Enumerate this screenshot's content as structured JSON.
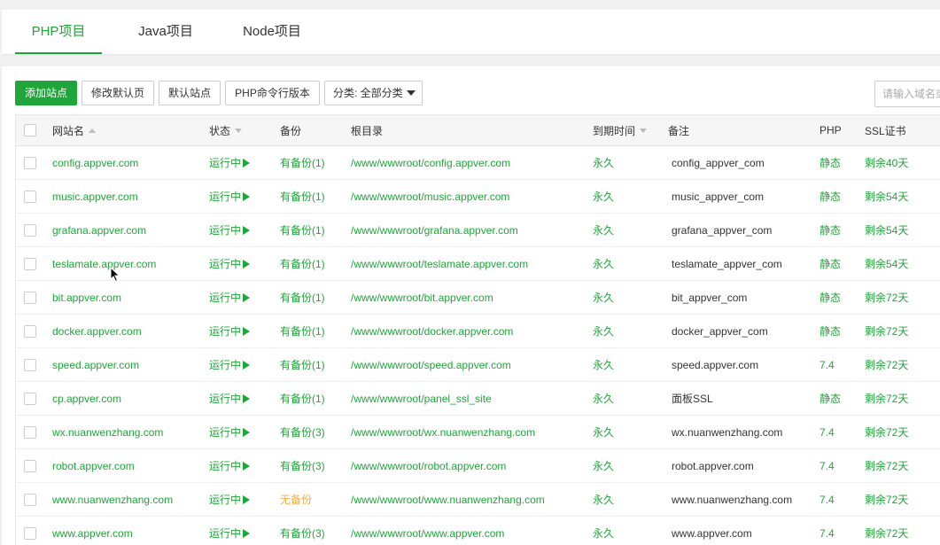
{
  "tabs": [
    {
      "label": "PHP项目",
      "active": true
    },
    {
      "label": "Java项目",
      "active": false
    },
    {
      "label": "Node项目",
      "active": false
    }
  ],
  "toolbar": {
    "add_site": "添加站点",
    "edit_default_page": "修改默认页",
    "default_site": "默认站点",
    "php_cli_version": "PHP命令行版本",
    "category_select": "分类: 全部分类",
    "search_placeholder": "请输入域名或备注"
  },
  "table": {
    "headers": {
      "site_name": "网站名",
      "status": "状态",
      "backup": "备份",
      "root": "根目录",
      "expiry": "到期时间",
      "remark": "备注",
      "php": "PHP",
      "ssl": "SSL证书"
    },
    "rows": [
      {
        "name": "config.appver.com",
        "status": "运行中",
        "backup": "有备份(1)",
        "root": "/www/wwwroot/config.appver.com",
        "expiry": "永久",
        "remark": "config_appver_com",
        "php": "静态",
        "ssl": "剩余40天"
      },
      {
        "name": "music.appver.com",
        "status": "运行中",
        "backup": "有备份(1)",
        "root": "/www/wwwroot/music.appver.com",
        "expiry": "永久",
        "remark": "music_appver_com",
        "php": "静态",
        "ssl": "剩余54天"
      },
      {
        "name": "grafana.appver.com",
        "status": "运行中",
        "backup": "有备份(1)",
        "root": "/www/wwwroot/grafana.appver.com",
        "expiry": "永久",
        "remark": "grafana_appver_com",
        "php": "静态",
        "ssl": "剩余54天"
      },
      {
        "name": "teslamate.appver.com",
        "status": "运行中",
        "backup": "有备份(1)",
        "root": "/www/wwwroot/teslamate.appver.com",
        "expiry": "永久",
        "remark": "teslamate_appver_com",
        "php": "静态",
        "ssl": "剩余54天"
      },
      {
        "name": "bit.appver.com",
        "status": "运行中",
        "backup": "有备份(1)",
        "root": "/www/wwwroot/bit.appver.com",
        "expiry": "永久",
        "remark": "bit_appver_com",
        "php": "静态",
        "ssl": "剩余72天"
      },
      {
        "name": "docker.appver.com",
        "status": "运行中",
        "backup": "有备份(1)",
        "root": "/www/wwwroot/docker.appver.com",
        "expiry": "永久",
        "remark": "docker_appver_com",
        "php": "静态",
        "ssl": "剩余72天"
      },
      {
        "name": "speed.appver.com",
        "status": "运行中",
        "backup": "有备份(1)",
        "root": "/www/wwwroot/speed.appver.com",
        "expiry": "永久",
        "remark": "speed.appver.com",
        "php": "7.4",
        "ssl": "剩余72天"
      },
      {
        "name": "cp.appver.com",
        "status": "运行中",
        "backup": "有备份(1)",
        "root": "/www/wwwroot/panel_ssl_site",
        "expiry": "永久",
        "remark": "面板SSL",
        "php": "静态",
        "ssl": "剩余72天"
      },
      {
        "name": "wx.nuanwenzhang.com",
        "status": "运行中",
        "backup": "有备份(3)",
        "root": "/www/wwwroot/wx.nuanwenzhang.com",
        "expiry": "永久",
        "remark": "wx.nuanwenzhang.com",
        "php": "7.4",
        "ssl": "剩余72天"
      },
      {
        "name": "robot.appver.com",
        "status": "运行中",
        "backup": "有备份(3)",
        "root": "/www/wwwroot/robot.appver.com",
        "expiry": "永久",
        "remark": "robot.appver.com",
        "php": "7.4",
        "ssl": "剩余72天"
      },
      {
        "name": "www.nuanwenzhang.com",
        "status": "运行中",
        "backup": "无备份",
        "root": "/www/wwwroot/www.nuanwenzhang.com",
        "expiry": "永久",
        "remark": "www.nuanwenzhang.com",
        "php": "7.4",
        "ssl": "剩余72天"
      },
      {
        "name": "www.appver.com",
        "status": "运行中",
        "backup": "有备份(3)",
        "root": "/www/wwwroot/www.appver.com",
        "expiry": "永久",
        "remark": "www.appver.com",
        "php": "7.4",
        "ssl": "剩余72天"
      }
    ]
  },
  "colors": {
    "accent": "#20a53a",
    "no_backup": "#f0ad4e",
    "header_bg": "#f6f6f6"
  },
  "icons": {
    "status": "play-icon",
    "sort": "sort-icon",
    "dropdown": "caret-down-icon",
    "cursor": "mouse-pointer-icon"
  }
}
